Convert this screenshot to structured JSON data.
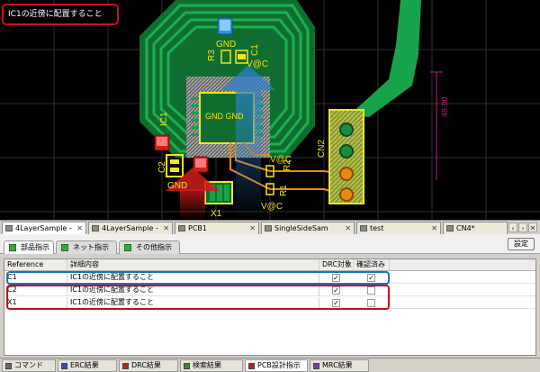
{
  "callout": {
    "text": "IC1の近傍に配置すること"
  },
  "pcb": {
    "labels": {
      "gnd_top": "GND",
      "r3": "R3",
      "c1": "C1",
      "vcc_top": "V@C",
      "ic1": "IC1",
      "gnd_center": "GND GND",
      "cn2": "CN2",
      "c2": "C2",
      "vcc_mid": "V@C",
      "r2": "R2",
      "gnd_bottom": "GND",
      "r1": "R1",
      "vcc_bottom": "V@C",
      "x1": "X1",
      "dim": "46.00"
    }
  },
  "doc_tabs": [
    {
      "label": "4LayerSample -",
      "active": true
    },
    {
      "label": "4LayerSample -",
      "active": false
    },
    {
      "label": "PCB1",
      "active": false
    },
    {
      "label": "SingleSideSam",
      "active": false
    },
    {
      "label": "test",
      "active": false
    },
    {
      "label": "CN4*",
      "active": false
    }
  ],
  "sub_tabs": [
    {
      "label": "部品指示",
      "active": true
    },
    {
      "label": "ネット指示",
      "active": false
    },
    {
      "label": "その他指示",
      "active": false
    }
  ],
  "setting_button": "設定",
  "table": {
    "headers": {
      "reference": "Reference",
      "detail": "詳細内容",
      "drc": "DRC対象",
      "confirmed": "確認済み"
    },
    "rows": [
      {
        "reference": "C1",
        "detail": "IC1の近傍に配置すること",
        "drc": true,
        "confirmed": true
      },
      {
        "reference": "C2",
        "detail": "IC1の近傍に配置すること",
        "drc": true,
        "confirmed": false
      },
      {
        "reference": "X1",
        "detail": "IC1の近傍に配置すること",
        "drc": true,
        "confirmed": false
      }
    ]
  },
  "bottom_tabs": [
    {
      "label": "コマンド",
      "icon_color": "#6b6b6b",
      "active": false
    },
    {
      "label": "ERC結果",
      "icon_color": "#3a4bb8",
      "active": false
    },
    {
      "label": "DRC結果",
      "icon_color": "#c0201e",
      "active": false
    },
    {
      "label": "検索結果",
      "icon_color": "#2f8f2f",
      "active": false
    },
    {
      "label": "PCB設計指示",
      "icon_color": "#c0201e",
      "active": true
    },
    {
      "label": "MRC結果",
      "icon_color": "#7a3ab0",
      "active": false
    }
  ],
  "colors": {
    "board_green": "#17a34a",
    "trace_orange": "#e98a12",
    "outline_yellow": "#f2e51a",
    "highlight_blue": "#1e73b8",
    "highlight_red": "#c4101e"
  }
}
